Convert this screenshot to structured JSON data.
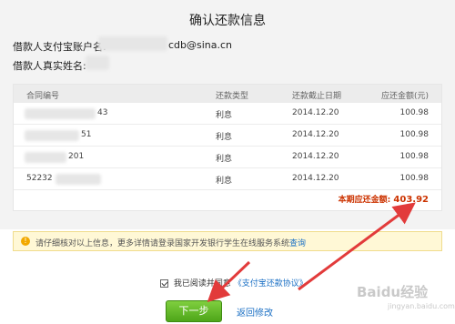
{
  "page": {
    "title": "确认还款信息",
    "account_label": "借款人支付宝账户名:",
    "account_suffix": "cdb@sina.cn",
    "name_label": "借款人真实姓名:"
  },
  "table": {
    "headers": [
      "合同编号",
      "还款类型",
      "还款截止日期",
      "应还金额(元)"
    ],
    "rows": [
      {
        "contract": "43",
        "type": "利息",
        "date": "2014.12.20",
        "amount": "100.98"
      },
      {
        "contract": "51",
        "type": "利息",
        "date": "2014.12.20",
        "amount": "100.98"
      },
      {
        "contract": "201",
        "type": "利息",
        "date": "2014.12.20",
        "amount": "100.98"
      },
      {
        "contract": "52232",
        "type": "利息",
        "date": "2014.12.20",
        "amount": "100.98"
      }
    ],
    "total_label": "本期应还金额:",
    "total_amount": "403.92"
  },
  "notice": {
    "text": "请仔细核对以上信息，更多详情请登录国家开发银行学生在线服务系统",
    "link": "查询"
  },
  "agreement": {
    "text": "我已阅读并同意",
    "link": "《支付宝还款协议》"
  },
  "actions": {
    "next_label": "下一步",
    "back_label": "返回修改"
  },
  "watermark": {
    "main": "Baidu经验",
    "sub": "jingyan.baidu.com"
  },
  "colors": {
    "accent_red": "#cc3300",
    "button_green": "#5cb82a",
    "link_blue": "#1a6fc4",
    "arrow_red": "#e23b3b"
  }
}
